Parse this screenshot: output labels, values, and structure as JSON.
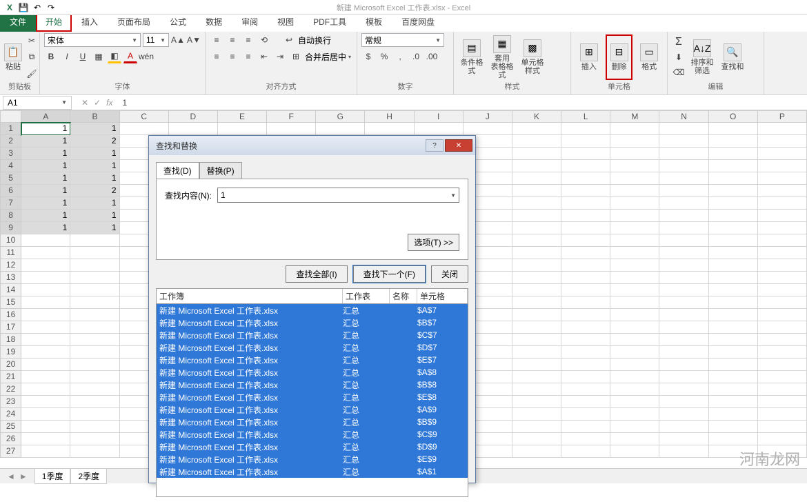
{
  "title": "新建 Microsoft Excel 工作表.xlsx - Excel",
  "tabs": {
    "file": "文件",
    "home": "开始",
    "insert": "插入",
    "layout": "页面布局",
    "formulas": "公式",
    "data": "数据",
    "review": "审阅",
    "view": "视图",
    "pdf": "PDF工具",
    "template": "模板",
    "baidu": "百度网盘"
  },
  "groups": {
    "clipboard": "剪贴板",
    "font": "字体",
    "alignment": "对齐方式",
    "number": "数字",
    "styles": "样式",
    "cells": "单元格",
    "editing": "编辑"
  },
  "buttons": {
    "paste": "粘贴",
    "condfmt": "条件格式",
    "tablefmt": "套用\n表格格式",
    "cellstyle": "单元格样式",
    "insertc": "插入",
    "deletec": "删除",
    "format": "格式",
    "sortfilter": "排序和筛选",
    "findl": "查找和"
  },
  "font": {
    "name": "宋体",
    "size": "11"
  },
  "wrap": "自动换行",
  "merge": "合并后居中",
  "numfmt": "常规",
  "namebox": "A1",
  "formula": "1",
  "cols": [
    "A",
    "B",
    "C",
    "D",
    "E",
    "F",
    "G",
    "H",
    "I",
    "J",
    "K",
    "L",
    "M",
    "N",
    "O",
    "P"
  ],
  "cell_data": [
    [
      "1",
      "1"
    ],
    [
      "1",
      "2"
    ],
    [
      "1",
      "1"
    ],
    [
      "1",
      "1"
    ],
    [
      "1",
      "1"
    ],
    [
      "1",
      "2"
    ],
    [
      "1",
      "1"
    ],
    [
      "1",
      "1"
    ],
    [
      "1",
      "1"
    ]
  ],
  "sheets": {
    "s1": "1季度",
    "s2": "2季度"
  },
  "dialog": {
    "title": "查找和替换",
    "tab_find": "查找(D)",
    "tab_replace": "替换(P)",
    "lbl_content": "查找内容(N):",
    "value": "1",
    "btn_options": "选项(T) >>",
    "btn_findall": "查找全部(I)",
    "btn_findnext": "查找下一个(F)",
    "btn_close": "关闭",
    "th_wb": "工作簿",
    "th_ws": "工作表",
    "th_nm": "名称",
    "th_cell": "单元格",
    "results": [
      {
        "wb": "新建 Microsoft Excel 工作表.xlsx",
        "ws": "汇总",
        "cell": "$A$7"
      },
      {
        "wb": "新建 Microsoft Excel 工作表.xlsx",
        "ws": "汇总",
        "cell": "$B$7"
      },
      {
        "wb": "新建 Microsoft Excel 工作表.xlsx",
        "ws": "汇总",
        "cell": "$C$7"
      },
      {
        "wb": "新建 Microsoft Excel 工作表.xlsx",
        "ws": "汇总",
        "cell": "$D$7"
      },
      {
        "wb": "新建 Microsoft Excel 工作表.xlsx",
        "ws": "汇总",
        "cell": "$E$7"
      },
      {
        "wb": "新建 Microsoft Excel 工作表.xlsx",
        "ws": "汇总",
        "cell": "$A$8"
      },
      {
        "wb": "新建 Microsoft Excel 工作表.xlsx",
        "ws": "汇总",
        "cell": "$B$8"
      },
      {
        "wb": "新建 Microsoft Excel 工作表.xlsx",
        "ws": "汇总",
        "cell": "$E$8"
      },
      {
        "wb": "新建 Microsoft Excel 工作表.xlsx",
        "ws": "汇总",
        "cell": "$A$9"
      },
      {
        "wb": "新建 Microsoft Excel 工作表.xlsx",
        "ws": "汇总",
        "cell": "$B$9"
      },
      {
        "wb": "新建 Microsoft Excel 工作表.xlsx",
        "ws": "汇总",
        "cell": "$C$9"
      },
      {
        "wb": "新建 Microsoft Excel 工作表.xlsx",
        "ws": "汇总",
        "cell": "$D$9"
      },
      {
        "wb": "新建 Microsoft Excel 工作表.xlsx",
        "ws": "汇总",
        "cell": "$E$9"
      },
      {
        "wb": "新建 Microsoft Excel 工作表.xlsx",
        "ws": "汇总",
        "cell": "$A$1"
      }
    ]
  },
  "watermark": "河南龙网"
}
